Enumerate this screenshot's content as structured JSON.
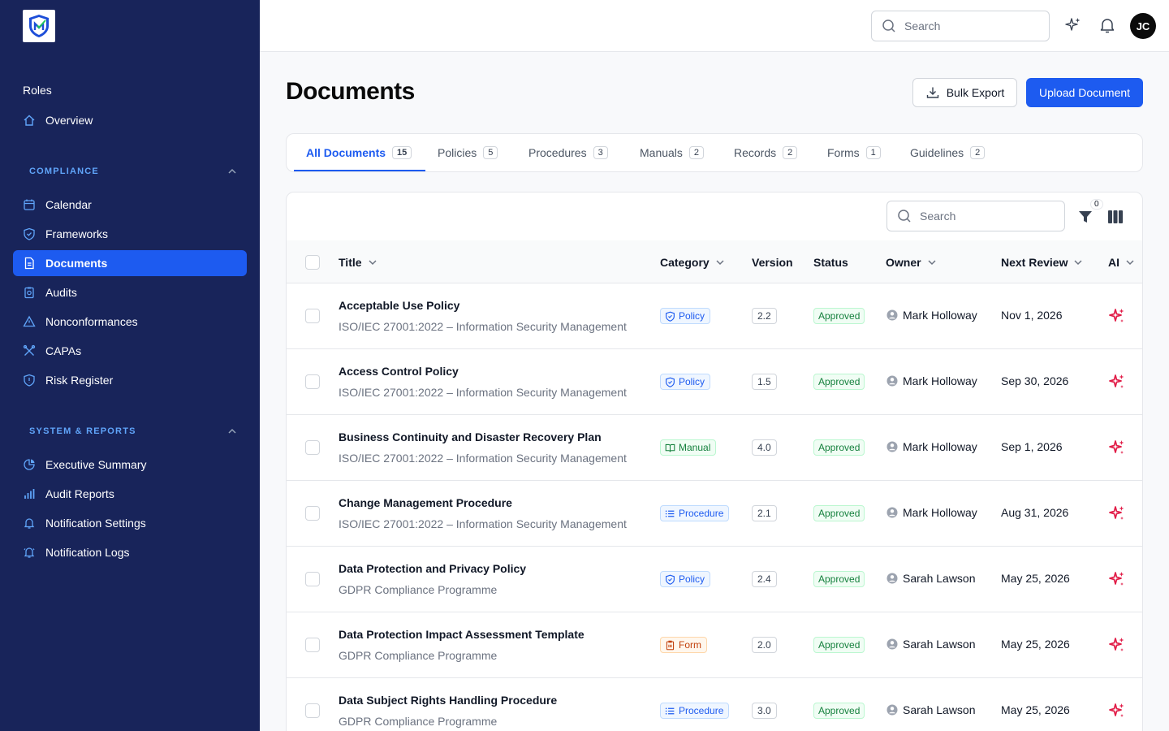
{
  "sidebar": {
    "roles_label": "Roles",
    "overview": "Overview",
    "compliance_title": "COMPLIANCE",
    "compliance_items": [
      "Calendar",
      "Frameworks",
      "Documents",
      "Audits",
      "Nonconformances",
      "CAPAs",
      "Risk Register"
    ],
    "active_item": "Documents",
    "reports_title": "SYSTEM & REPORTS",
    "reports_items": [
      "Executive Summary",
      "Audit Reports",
      "Notification Settings",
      "Notification Logs"
    ]
  },
  "topbar": {
    "search_placeholder": "Search",
    "avatar_initials": "JC"
  },
  "header": {
    "title": "Documents",
    "bulk_export": "Bulk Export",
    "upload": "Upload Document"
  },
  "tabs": [
    {
      "label": "All Documents",
      "count": "15"
    },
    {
      "label": "Policies",
      "count": "5"
    },
    {
      "label": "Procedures",
      "count": "3"
    },
    {
      "label": "Manuals",
      "count": "2"
    },
    {
      "label": "Records",
      "count": "2"
    },
    {
      "label": "Forms",
      "count": "1"
    },
    {
      "label": "Guidelines",
      "count": "2"
    }
  ],
  "table": {
    "search_placeholder": "Search",
    "filter_count": "0",
    "columns": {
      "title": "Title",
      "category": "Category",
      "version": "Version",
      "status": "Status",
      "owner": "Owner",
      "next_review": "Next Review",
      "ai": "AI"
    },
    "rows": [
      {
        "title": "Acceptable Use Policy",
        "subtitle": "ISO/IEC 27001:2022 – Information Security Management",
        "category": "Policy",
        "version": "2.2",
        "status": "Approved",
        "owner": "Mark Holloway",
        "next_review": "Nov 1, 2026"
      },
      {
        "title": "Access Control Policy",
        "subtitle": "ISO/IEC 27001:2022 – Information Security Management",
        "category": "Policy",
        "version": "1.5",
        "status": "Approved",
        "owner": "Mark Holloway",
        "next_review": "Sep 30, 2026"
      },
      {
        "title": "Business Continuity and Disaster Recovery Plan",
        "subtitle": "ISO/IEC 27001:2022 – Information Security Management",
        "category": "Manual",
        "version": "4.0",
        "status": "Approved",
        "owner": "Mark Holloway",
        "next_review": "Sep 1, 2026"
      },
      {
        "title": "Change Management Procedure",
        "subtitle": "ISO/IEC 27001:2022 – Information Security Management",
        "category": "Procedure",
        "version": "2.1",
        "status": "Approved",
        "owner": "Mark Holloway",
        "next_review": "Aug 31, 2026"
      },
      {
        "title": "Data Protection and Privacy Policy",
        "subtitle": "GDPR Compliance Programme",
        "category": "Policy",
        "version": "2.4",
        "status": "Approved",
        "owner": "Sarah Lawson",
        "next_review": "May 25, 2026"
      },
      {
        "title": "Data Protection Impact Assessment Template",
        "subtitle": "GDPR Compliance Programme",
        "category": "Form",
        "version": "2.0",
        "status": "Approved",
        "owner": "Sarah Lawson",
        "next_review": "May 25, 2026"
      },
      {
        "title": "Data Subject Rights Handling Procedure",
        "subtitle": "GDPR Compliance Programme",
        "category": "Procedure",
        "version": "3.0",
        "status": "Approved",
        "owner": "Sarah Lawson",
        "next_review": "May 25, 2026"
      }
    ]
  },
  "colors": {
    "sidebar_bg": "#18245a",
    "accent": "#1d5bf0",
    "ai_icon": "#e11d48",
    "section_title": "#60a5fa"
  }
}
